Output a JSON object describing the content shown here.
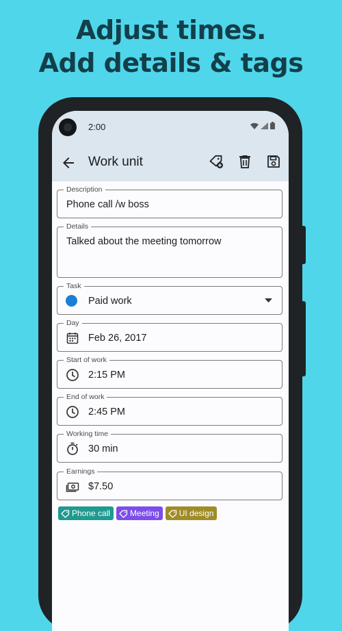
{
  "headline": {
    "line1": "Adjust times.",
    "line2": "Add details & tags"
  },
  "status": {
    "time": "2:00"
  },
  "appbar": {
    "title": "Work unit",
    "icons": [
      "back-arrow-icon",
      "add-tag-icon",
      "delete-icon",
      "save-icon"
    ]
  },
  "fields": {
    "description": {
      "label": "Description",
      "value": "Phone call /w boss"
    },
    "details": {
      "label": "Details",
      "value": "Talked about the meeting tomorrow"
    },
    "task": {
      "label": "Task",
      "value": "Paid work",
      "color": "#1a7fd6"
    },
    "day": {
      "label": "Day",
      "value": "Feb 26, 2017"
    },
    "start": {
      "label": "Start of work",
      "value": "2:15 PM"
    },
    "end": {
      "label": "End of work",
      "value": "2:45 PM"
    },
    "working": {
      "label": "Working time",
      "value": "30 min"
    },
    "earnings": {
      "label": "Earnings",
      "value": "$7.50"
    }
  },
  "tags": [
    {
      "label": "Phone call",
      "color": "#1f9a8f"
    },
    {
      "label": "Meeting",
      "color": "#7c4dea"
    },
    {
      "label": "UI design",
      "color": "#a08c26"
    }
  ]
}
